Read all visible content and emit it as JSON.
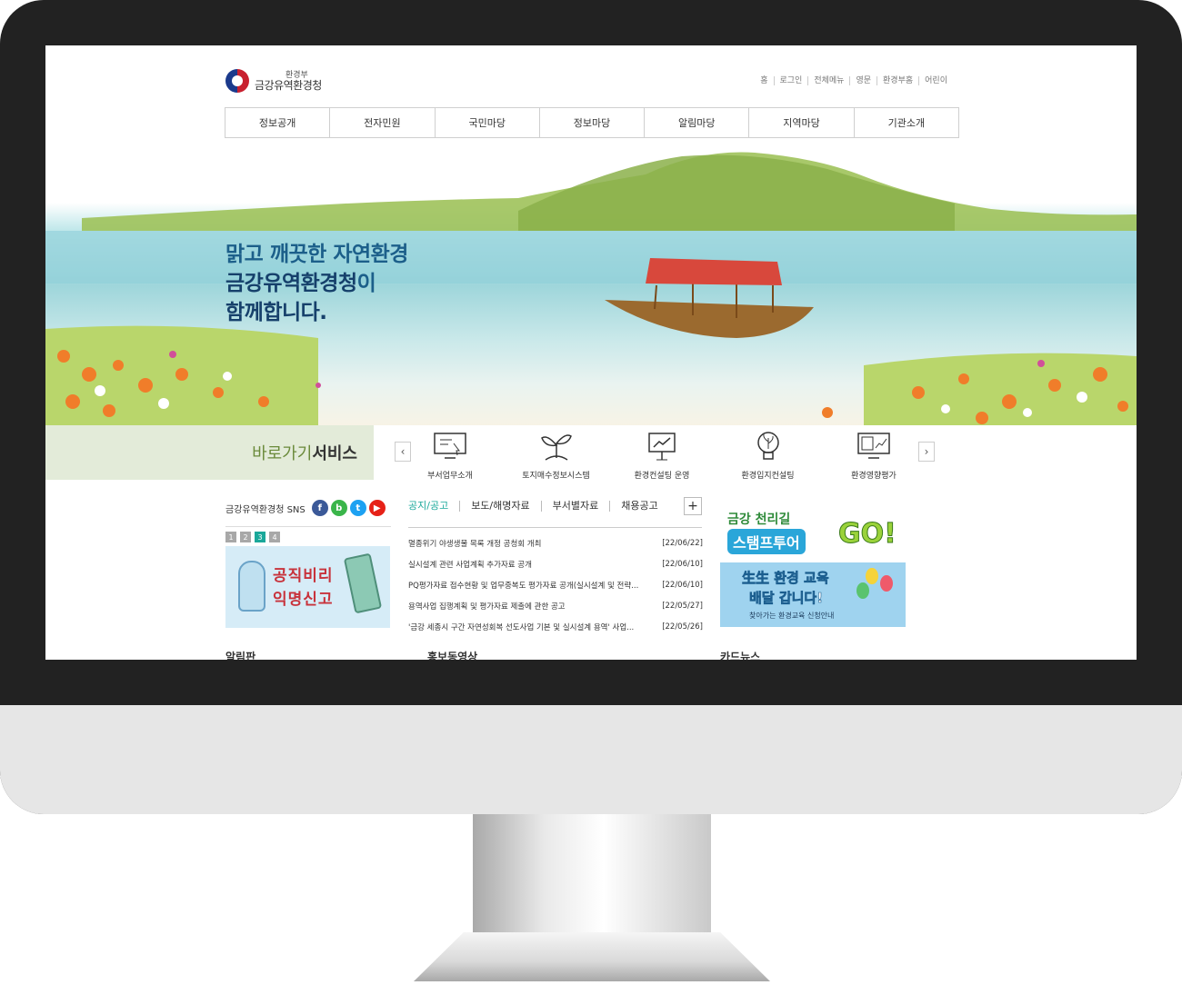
{
  "site": {
    "logo_sup": "환경부",
    "logo_name": "금강유역환경청"
  },
  "util_links": [
    "홈",
    "로그인",
    "전체메뉴",
    "영문",
    "환경부홈",
    "어린이"
  ],
  "gnb": [
    "정보공개",
    "전자민원",
    "국민마당",
    "정보마당",
    "알림마당",
    "지역마당",
    "기관소개"
  ],
  "hero": {
    "line1": "맑고 깨끗한 자연환경",
    "line2_strong": "금강유역환경청",
    "line2_tail": "이",
    "line3": "함께합니다."
  },
  "quick": {
    "title_a": "바로가기",
    "title_b": "서비스",
    "prev": "‹",
    "next": "›",
    "items": [
      {
        "label": "부서업무소개",
        "icon": "monitor-icon"
      },
      {
        "label": "토지매수정보시스템",
        "icon": "sprout-icon"
      },
      {
        "label": "환경컨설팅 운영",
        "icon": "presentation-icon"
      },
      {
        "label": "환경입지컨설팅",
        "icon": "lightbulb-leaf-icon"
      },
      {
        "label": "환경영향평가",
        "icon": "chart-monitor-icon"
      }
    ]
  },
  "sns": {
    "label": "금강유역환경청 SNS",
    "buttons": [
      {
        "name": "facebook-icon",
        "glyph": "f",
        "color": "#3b5998"
      },
      {
        "name": "blog-icon",
        "glyph": "b",
        "color": "#3ab54a"
      },
      {
        "name": "twitter-icon",
        "glyph": "t",
        "color": "#1da1f2"
      },
      {
        "name": "youtube-icon",
        "glyph": "▶",
        "color": "#e62117"
      }
    ]
  },
  "pager": [
    "1",
    "2",
    "3",
    "4"
  ],
  "left_banner": {
    "line1": "공직비리",
    "line2": "익명신고"
  },
  "board": {
    "tabs": [
      "공지/공고",
      "보도/해명자료",
      "부서별자료",
      "채용공고"
    ],
    "more": "+",
    "notices": [
      {
        "title": "멸종위기 야생생물 목록 개정 공청회 개최",
        "date": "[22/06/22]"
      },
      {
        "title": "실시설계 관련 사업계획 추가자료 공개",
        "date": "[22/06/10]"
      },
      {
        "title": "PQ평가자료 접수현황 및 업무중복도 평가자료 공개(실시설계 및 전략...",
        "date": "[22/06/10]"
      },
      {
        "title": "용역사업 집행계획 및 평가자료 제출에 관한 공고",
        "date": "[22/05/27]"
      },
      {
        "title": "'금강 세종시 구간 자연성회복 선도사업 기본 및 실시설계 용역' 사업...",
        "date": "[22/05/26]"
      }
    ]
  },
  "right_banners": {
    "b1_a": "금강 천리길",
    "b1_b": "스탬프투어",
    "b1_go": "GO!",
    "b2_a": "生生 환경 교육",
    "b2_b": "배달 갑니다!",
    "b2_c": "찾아가는 환경교육 신청안내"
  },
  "sections": [
    "알림판",
    "홍보동영상",
    "카드뉴스"
  ],
  "colors": {
    "accent": "#1aa89a",
    "hero_text": "#1c5f8a",
    "quick_bg": "#e3ebd9"
  }
}
